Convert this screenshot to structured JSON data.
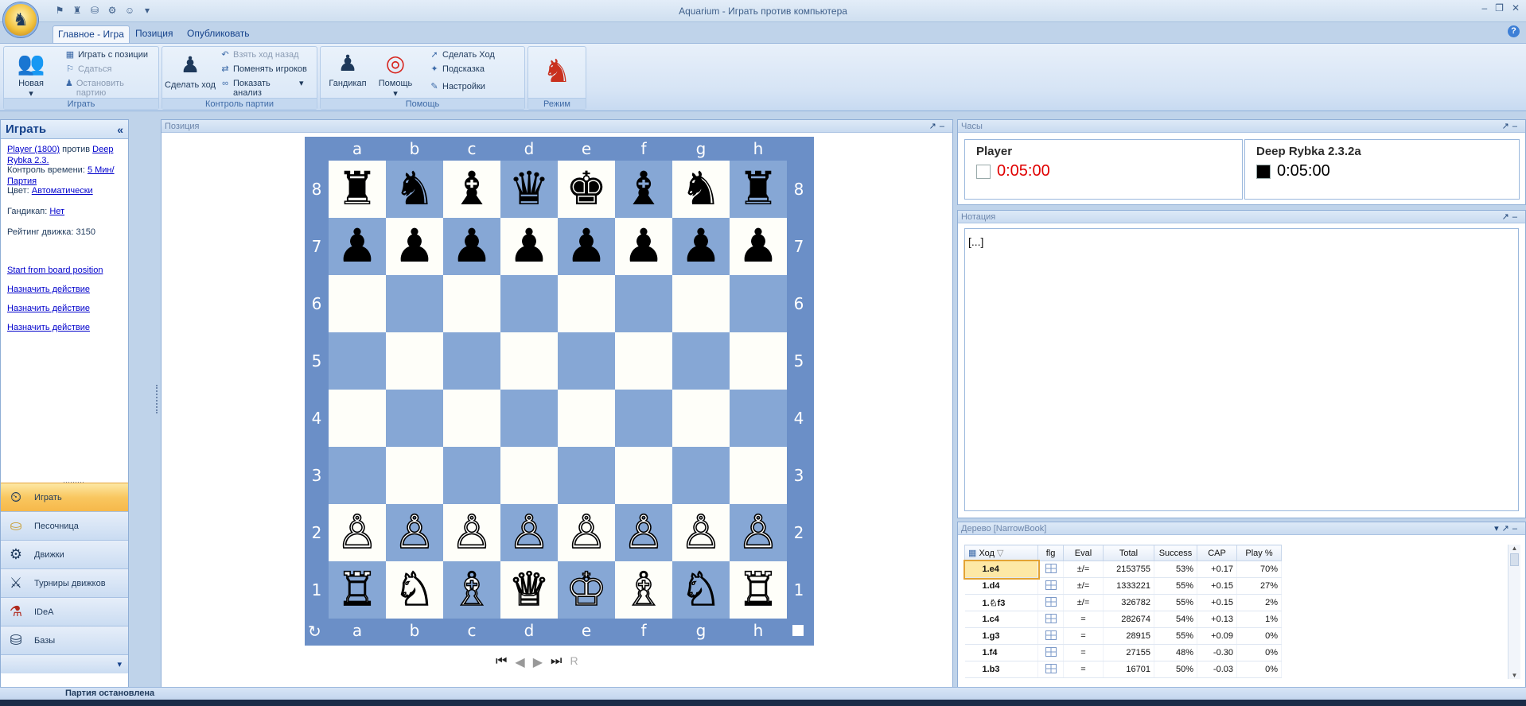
{
  "window": {
    "title": "Aquarium - Играть против компьютера",
    "controls": [
      "‒",
      "❐",
      "✕"
    ]
  },
  "tabs": [
    {
      "label": "Главное - Игра"
    },
    {
      "label": "Позиция"
    },
    {
      "label": "Опубликовать"
    }
  ],
  "ribbon": {
    "group1": {
      "label": "Играть",
      "new": "Новая",
      "play_from": "Играть с позиции",
      "resign": "Сдаться",
      "stop": "Остановить партию"
    },
    "group2": {
      "label": "Контроль партии",
      "make_move": "Сделать ход",
      "take_back": "Взять ход назад",
      "swap": "Поменять игроков",
      "analysis": "Показать анализ"
    },
    "group3": {
      "label": "Помощь",
      "handicap": "Гандикап",
      "help": "Помощь",
      "do_move": "Сделать Ход",
      "hint": "Подсказка",
      "settings": "Настройки"
    },
    "group4": {
      "label": "Режим"
    }
  },
  "left_panel": {
    "title": "Играть",
    "player": "Player (1800)",
    "vs": "против",
    "engine": "Deep Rybka 2.3.",
    "time_label": "Контроль времени:",
    "time_value": "5 Мин/Партия",
    "color_label": "Цвет:",
    "color_value": "Автоматически",
    "handicap_label": "Гандикап:",
    "handicap_value": "Нет",
    "rating": "Рейтинг движка: 3150",
    "links": [
      "Start from board position",
      "Назначить действие",
      "Назначить действие",
      "Назначить действие"
    ]
  },
  "nav": [
    {
      "label": "Играть",
      "icon": "play-clock-icon"
    },
    {
      "label": "Песочница",
      "icon": "bucket-icon"
    },
    {
      "label": "Движки",
      "icon": "engine-gear-icon"
    },
    {
      "label": "Турниры движков",
      "icon": "vs-icon"
    },
    {
      "label": "IDeA",
      "icon": "microscope-icon"
    },
    {
      "label": "Базы",
      "icon": "database-icon"
    }
  ],
  "center": {
    "panel_title": "Позиция"
  },
  "board": {
    "files": [
      "a",
      "b",
      "c",
      "d",
      "e",
      "f",
      "g",
      "h"
    ],
    "ranks": [
      "8",
      "7",
      "6",
      "5",
      "4",
      "3",
      "2",
      "1"
    ],
    "position": [
      [
        "♜",
        "♞",
        "♝",
        "♛",
        "♚",
        "♝",
        "♞",
        "♜"
      ],
      [
        "♟",
        "♟",
        "♟",
        "♟",
        "♟",
        "♟",
        "♟",
        "♟"
      ],
      [
        "",
        "",
        "",
        "",
        "",
        "",
        "",
        ""
      ],
      [
        "",
        "",
        "",
        "",
        "",
        "",
        "",
        ""
      ],
      [
        "",
        "",
        "",
        "",
        "",
        "",
        "",
        ""
      ],
      [
        "",
        "",
        "",
        "",
        "",
        "",
        "",
        ""
      ],
      [
        "♙",
        "♙",
        "♙",
        "♙",
        "♙",
        "♙",
        "♙",
        "♙"
      ],
      [
        "♖",
        "♘",
        "♗",
        "♕",
        "♔",
        "♗",
        "♘",
        "♖"
      ]
    ],
    "light_color": "#fefef9",
    "dark_color": "#86a7d5",
    "frame_color": "#6b8fc7"
  },
  "clocks": {
    "panel_title": "Часы",
    "white": {
      "name": "Player",
      "time": "0:05:00",
      "color": "#e00000"
    },
    "black": {
      "name": "Deep Rybka 2.3.2a",
      "time": "0:05:00",
      "color": "#000000"
    }
  },
  "notation": {
    "panel_title": "Нотация",
    "text": "[...]"
  },
  "tree": {
    "panel_title": "Дерево [NarrowBook]",
    "columns": [
      "Ход",
      "flg",
      "Eval",
      "Total",
      "Success",
      "CAP",
      "Play %"
    ],
    "rows": [
      [
        "1.e4",
        "",
        "±/=",
        "2153755",
        "53%",
        "+0.17",
        "70%"
      ],
      [
        "1.d4",
        "",
        "±/=",
        "1333221",
        "55%",
        "+0.15",
        "27%"
      ],
      [
        "1.♘f3",
        "",
        "±/=",
        "326782",
        "55%",
        "+0.15",
        "2%"
      ],
      [
        "1.c4",
        "",
        "=",
        "282674",
        "54%",
        "+0.13",
        "1%"
      ],
      [
        "1.g3",
        "",
        "=",
        "28915",
        "55%",
        "+0.09",
        "0%"
      ],
      [
        "1.f4",
        "",
        "=",
        "27155",
        "48%",
        "-0.30",
        "0%"
      ],
      [
        "1.b3",
        "",
        "=",
        "16701",
        "50%",
        "-0.03",
        "0%"
      ]
    ]
  },
  "status": {
    "text": "Партия остановлена"
  }
}
